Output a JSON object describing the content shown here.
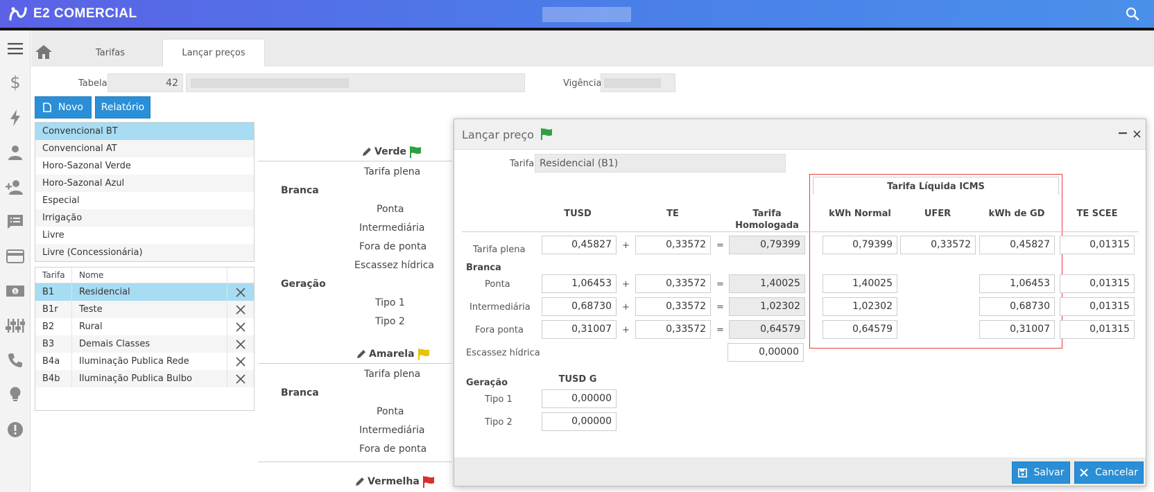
{
  "app": {
    "title": "E2 COMERCIAL"
  },
  "tabs": [
    {
      "label": "Tarifas"
    },
    {
      "label": "Lançar preços"
    }
  ],
  "form": {
    "tabela_label": "Tabela",
    "tabela_value": "42",
    "vigencia_label": "Vigência"
  },
  "toolbar": {
    "novo_label": "Novo",
    "relatorio_label": "Relatório"
  },
  "categories": [
    "Convencional BT",
    "Convencional AT",
    "Horo-Sazonal Verde",
    "Horo-Sazonal Azul",
    "Especial",
    "Irrigação",
    "Livre",
    "Livre (Concessionária)"
  ],
  "tariffs_table": {
    "headers": [
      "Tarifa",
      "Nome"
    ],
    "rows": [
      {
        "code": "B1",
        "name": "Residencial"
      },
      {
        "code": "B1r",
        "name": "Teste"
      },
      {
        "code": "B2",
        "name": "Rural"
      },
      {
        "code": "B3",
        "name": "Demais Classes"
      },
      {
        "code": "B4a",
        "name": "Iluminação Publica Rede"
      },
      {
        "code": "B4b",
        "name": "Iluminação Publica Bulbo"
      }
    ]
  },
  "background_panel": {
    "verde": "Verde",
    "amarela": "Amarela",
    "vermelha": "Vermelha",
    "tarifa_plena": "Tarifa plena",
    "branca": "Branca",
    "ponta": "Ponta",
    "intermediaria": "Intermediária",
    "fora_de_ponta": "Fora de ponta",
    "escassez_hidrica": "Escassez hídrica",
    "geracao": "Geração",
    "tipo1": "Tipo 1",
    "tipo2": "Tipo 2"
  },
  "dialog": {
    "title": "Lançar preço",
    "tarifa_label": "Tarifa",
    "tarifa_value": "Residencial (B1)",
    "group_label": "Tarifa Líquida ICMS",
    "columns": {
      "tusd": "TUSD",
      "te": "TE",
      "tarifa_homologada_1": "Tarifa",
      "tarifa_homologada_2": "Homologada",
      "kwh_normal": "kWh Normal",
      "ufer": "UFER",
      "kwh_gd": "kWh de GD",
      "te_scee": "TE SCEE"
    },
    "ops": {
      "plus": "+",
      "eq": "="
    },
    "rows": {
      "tarifa_plena": {
        "label": "Tarifa plena",
        "tusd": "0,45827",
        "te": "0,33572",
        "homologada": "0,79399",
        "kwh_normal": "0,79399",
        "ufer": "0,33572",
        "kwh_gd": "0,45827",
        "te_scee": "0,01315"
      },
      "branca_label": "Branca",
      "ponta": {
        "label": "Ponta",
        "tusd": "1,06453",
        "te": "0,33572",
        "homologada": "1,40025",
        "kwh_normal": "1,40025",
        "kwh_gd": "1,06453",
        "te_scee": "0,01315"
      },
      "intermediaria": {
        "label": "Intermediária",
        "tusd": "0,68730",
        "te": "0,33572",
        "homologada": "1,02302",
        "kwh_normal": "1,02302",
        "kwh_gd": "0,68730",
        "te_scee": "0,01315"
      },
      "fora_ponta": {
        "label": "Fora ponta",
        "tusd": "0,31007",
        "te": "0,33572",
        "homologada": "0,64579",
        "kwh_normal": "0,64579",
        "kwh_gd": "0,31007",
        "te_scee": "0,01315"
      },
      "escassez": {
        "label": "Escassez hídrica",
        "value": "0,00000"
      },
      "geracao_label": "Geração",
      "tusd_g_label": "TUSD G",
      "tipo1": {
        "label": "Tipo 1",
        "value": "0,00000"
      },
      "tipo2": {
        "label": "Tipo 2",
        "value": "0,00000"
      }
    },
    "salvar_label": "Salvar",
    "cancelar_label": "Cancelar"
  },
  "colors": {
    "accent": "#2a8fd6",
    "selection": "#a7dcf2",
    "highlight_box": "#e23c3c",
    "flag_green": "#2ea043",
    "flag_yellow": "#e8c400",
    "flag_red": "#d9302c"
  }
}
